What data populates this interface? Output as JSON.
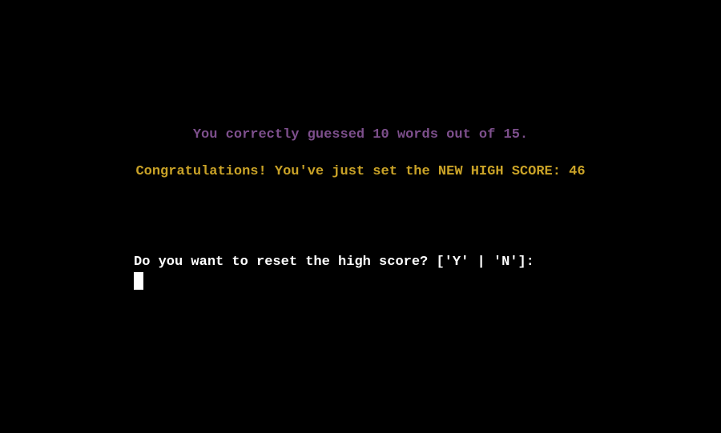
{
  "terminal": {
    "result_text": "You correctly guessed 10 words out of 15.",
    "high_score_text": "Congratulations! You've just set the NEW HIGH SCORE: 46",
    "reset_prompt": "Do you want to reset the high score? ['Y' | 'N']:",
    "input_value": ""
  },
  "colors": {
    "background": "#000000",
    "result": "#7d4f8c",
    "high_score": "#c9a227",
    "prompt": "#ffffff"
  }
}
